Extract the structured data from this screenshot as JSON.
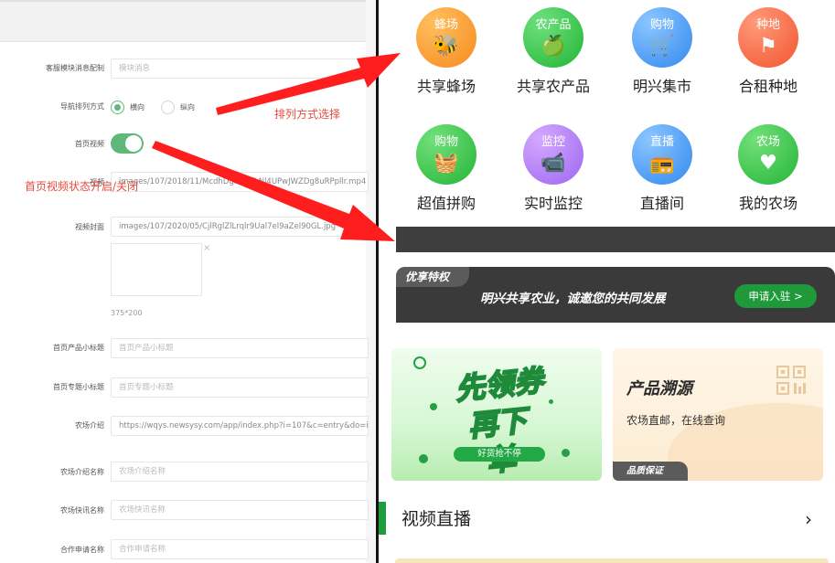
{
  "admin": {
    "rows": [
      {
        "label": "客服模块消息配制",
        "value": "",
        "placeholder": "模块消息"
      },
      {
        "label": "导航排列方式",
        "options": [
          "横向",
          "纵向"
        ],
        "selected": "横向"
      },
      {
        "label": "首页视频",
        "toggle": "on"
      },
      {
        "label": "视频",
        "value": "images/107/2018/11/McdhDgHaeYkNl4UPwJWZDg8uRPpllr.mp4"
      },
      {
        "label": "视频封面",
        "value": "images/107/2020/05/CjlRglZlLrqlr9Ual7el9aZel90GL.jpg"
      },
      {
        "label": "首页产品小标题",
        "value": "",
        "placeholder": "首页产品小标题"
      },
      {
        "label": "首页专题小标题",
        "value": "",
        "placeholder": "首页专题小标题"
      },
      {
        "label": "农场介绍",
        "value": "https://wqys.newsysy.com/app/index.php?i=107&c=entry&do=ind"
      },
      {
        "label": "农场介绍名称",
        "value": "",
        "placeholder": "农场介绍名称"
      },
      {
        "label": "农场快讯名称",
        "value": "",
        "placeholder": "农场快讯名称"
      },
      {
        "label": "合作申请名称",
        "value": "",
        "placeholder": "合作申请名称"
      }
    ],
    "image_hint": "375*200",
    "close_glyph": "×"
  },
  "annotations": {
    "layout_choice": "排列方式选择",
    "video_toggle": "首页视频状态开启/关闭"
  },
  "preview": {
    "grid": [
      {
        "label": "共享蜂场",
        "icon_text": "蜂场",
        "icon": "bee-icon",
        "glyph": "🐝",
        "from": "#ffbf5e",
        "to": "#f78a1e"
      },
      {
        "label": "共享农产品",
        "icon_text": "农产品",
        "icon": "apple-icon",
        "glyph": "🍏",
        "from": "#6fe07d",
        "to": "#21b536"
      },
      {
        "label": "明兴集市",
        "icon_text": "购物",
        "icon": "cart-icon",
        "glyph": "🛒",
        "from": "#8cc6ff",
        "to": "#3288ef"
      },
      {
        "label": "合租种地",
        "icon_text": "种地",
        "icon": "flag-icon",
        "glyph": "⚑",
        "from": "#ff9a7a",
        "to": "#f2552e"
      },
      {
        "label": "超值拼购",
        "icon_text": "购物",
        "icon": "basket-icon",
        "glyph": "🧺",
        "from": "#72e07a",
        "to": "#24b538"
      },
      {
        "label": "实时监控",
        "icon_text": "监控",
        "icon": "camera-icon",
        "glyph": "📹",
        "from": "#d5a8ff",
        "to": "#9c66f0"
      },
      {
        "label": "直播间",
        "icon_text": "直播",
        "icon": "radio-icon",
        "glyph": "📻",
        "from": "#8cc6ff",
        "to": "#3288ef"
      },
      {
        "label": "我的农场",
        "icon_text": "农场",
        "icon": "heart-icon",
        "glyph": "♥",
        "from": "#72e07a",
        "to": "#24b538"
      }
    ],
    "promo": {
      "tag": "优享特权",
      "text": "明兴共享农业，诚邀您的共同发展",
      "button": "申请入驻 >"
    },
    "coupon": {
      "line1": "先领券",
      "line2": "再下单",
      "line3": "好货抢不停"
    },
    "trace": {
      "title": "产品溯源",
      "sub": "农场直邮，在线查询",
      "tag": "品质保证"
    },
    "section": {
      "title": "视频直播",
      "arrow": "›"
    }
  }
}
